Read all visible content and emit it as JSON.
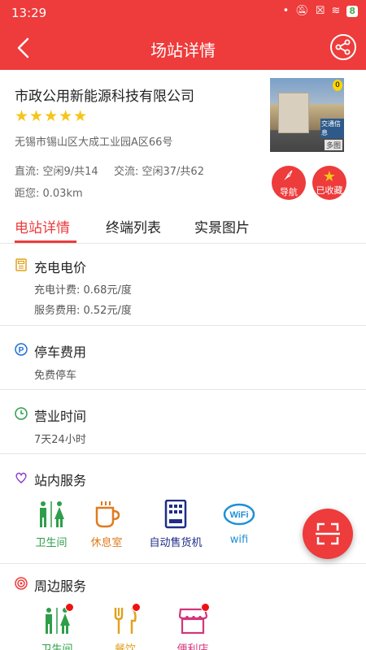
{
  "status": {
    "time": "13:29",
    "battery": "8"
  },
  "header": {
    "title": "场站详情"
  },
  "station": {
    "name": "市政公用新能源科技有限公司",
    "stars": "★★★★★",
    "address": "无锡市锡山区大成工业园A区66号",
    "dc": "直流: 空闲9/共14",
    "ac": "交流: 空闲37/共62",
    "distance": "距您: 0.03km",
    "photo_more": "多图",
    "photo_badge": "0",
    "photo_sign": "交通信息",
    "nav_label": "导航",
    "fav_label": "已收藏"
  },
  "tabs": [
    "电站详情",
    "终端列表",
    "实景图片"
  ],
  "price": {
    "title": "充电电价",
    "charge_fee": "充电计费: 0.68元/度",
    "service_fee": "服务费用: 0.52元/度"
  },
  "parking": {
    "title": "停车费用",
    "value": "免费停车"
  },
  "hours": {
    "title": "营业时间",
    "value": "7天24小时"
  },
  "services": {
    "title": "站内服务",
    "items": [
      {
        "label": "卫生间",
        "color": "#2e9e4a",
        "icon": "restroom-icon"
      },
      {
        "label": "休息室",
        "color": "#e07b1f",
        "icon": "coffee-icon"
      },
      {
        "label": "自动售货机",
        "color": "#1f2d86",
        "icon": "vending-machine-icon"
      },
      {
        "label": "wifi",
        "color": "#1e90d6",
        "icon": "wifi-icon"
      }
    ]
  },
  "nearby": {
    "title": "周边服务",
    "items": [
      {
        "label": "卫生间",
        "color": "#2e9e4a",
        "icon": "restroom-icon"
      },
      {
        "label": "餐饮",
        "color": "#e0a21f",
        "icon": "fork-knife-icon"
      },
      {
        "label": "便利店",
        "color": "#d2367a",
        "icon": "store-icon"
      }
    ]
  }
}
